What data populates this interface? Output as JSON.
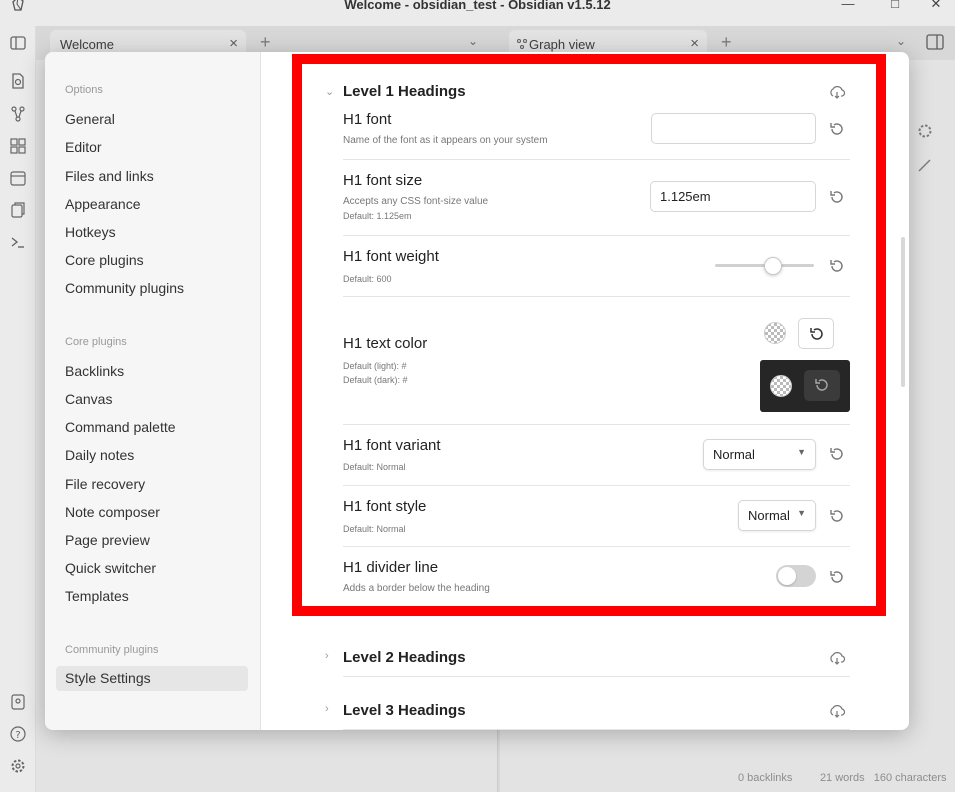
{
  "window": {
    "title": "Welcome - obsidian_test - Obsidian v1.5.12",
    "controls": {
      "minimize": "—",
      "maximize": "□",
      "close": "✕"
    }
  },
  "tabs": {
    "left": {
      "label": "Welcome",
      "close": "×"
    },
    "right": {
      "label": "Graph view",
      "close": "×"
    },
    "plus": "+",
    "chevron": "⌄"
  },
  "status_bar": {
    "backlinks": "0 backlinks",
    "words": "21 words",
    "characters": "160 characters"
  },
  "settings": {
    "close": "×",
    "sidebar": {
      "options_header": "Options",
      "options": [
        "General",
        "Editor",
        "Files and links",
        "Appearance",
        "Hotkeys",
        "Core plugins",
        "Community plugins"
      ],
      "core_header": "Core plugins",
      "core": [
        "Backlinks",
        "Canvas",
        "Command palette",
        "Daily notes",
        "File recovery",
        "Note composer",
        "Page preview",
        "Quick switcher",
        "Templates"
      ],
      "community_header": "Community plugins",
      "community": [
        "Style Settings"
      ]
    },
    "section_open": {
      "title": "Level 1 Headings",
      "chevron": "⌄",
      "items": {
        "font": {
          "name": "H1 font",
          "desc": "Name of the font as it appears on your system",
          "value": ""
        },
        "size": {
          "name": "H1 font size",
          "desc": "Accepts any CSS font-size value",
          "default": "Default: 1.125em",
          "value": "1.125em"
        },
        "weight": {
          "name": "H1 font weight",
          "default": "Default: 600",
          "slider_fraction": 0.6
        },
        "color": {
          "name": "H1 text color",
          "default_light": "Default (light): #",
          "default_dark": "Default (dark): #"
        },
        "variant": {
          "name": "H1 font variant",
          "default": "Default: Normal",
          "value": "Normal"
        },
        "style": {
          "name": "H1 font style",
          "default": "Default: Normal",
          "value": "Normal"
        },
        "divider": {
          "name": "H1 divider line",
          "desc": "Adds a border below the heading",
          "enabled": false
        }
      }
    },
    "section_2": {
      "title": "Level 2 Headings",
      "chevron": "›"
    },
    "section_3": {
      "title": "Level 3 Headings",
      "chevron": "›"
    },
    "caret": "▼"
  },
  "colors": {
    "highlight": "#ff0000",
    "modal_bg": "#ffffff",
    "sidebar_bg": "#f6f6f6"
  }
}
